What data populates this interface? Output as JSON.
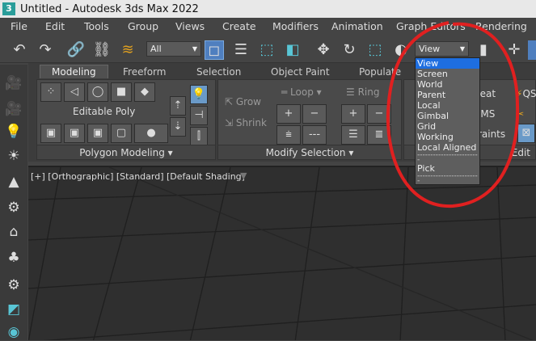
{
  "titlebar": {
    "app_icon": "3",
    "title": "Untitled - Autodesk 3ds Max 2022"
  },
  "menu": [
    "File",
    "Edit",
    "Tools",
    "Group",
    "Views",
    "Create",
    "Modifiers",
    "Animation",
    "Graph Editors",
    "Rendering"
  ],
  "toolbar": {
    "selection_filter": "All",
    "ref_coord": "View"
  },
  "ribbon": {
    "tabs": [
      "Modeling",
      "Freeform",
      "Selection",
      "Object Paint",
      "Populate"
    ],
    "editable_poly": "Editable Poly",
    "polygon_modeling": "Polygon Modeling ▾",
    "modify_selection": "Modify Selection ▾",
    "grow": "Grow",
    "shrink": "Shrink",
    "loop": "Loop ▾",
    "ring": "Ring",
    "repeat": "peat",
    "qs": "QS",
    "rms": "RMS",
    "constraints": "straints",
    "edit": "Edit"
  },
  "viewport": {
    "label": "[+] [Orthographic] [Standard] [Default Shading]"
  },
  "dropdown": {
    "items": [
      "View",
      "Screen",
      "World",
      "Parent",
      "Local",
      "Gimbal",
      "Grid",
      "Working",
      "Local Aligned"
    ],
    "separator": "------------------------",
    "pick": "Pick",
    "selected": "View"
  },
  "colors": {
    "accent": "#1e6ee0",
    "annotation": "#e02020",
    "teal": "#59c6d6"
  }
}
